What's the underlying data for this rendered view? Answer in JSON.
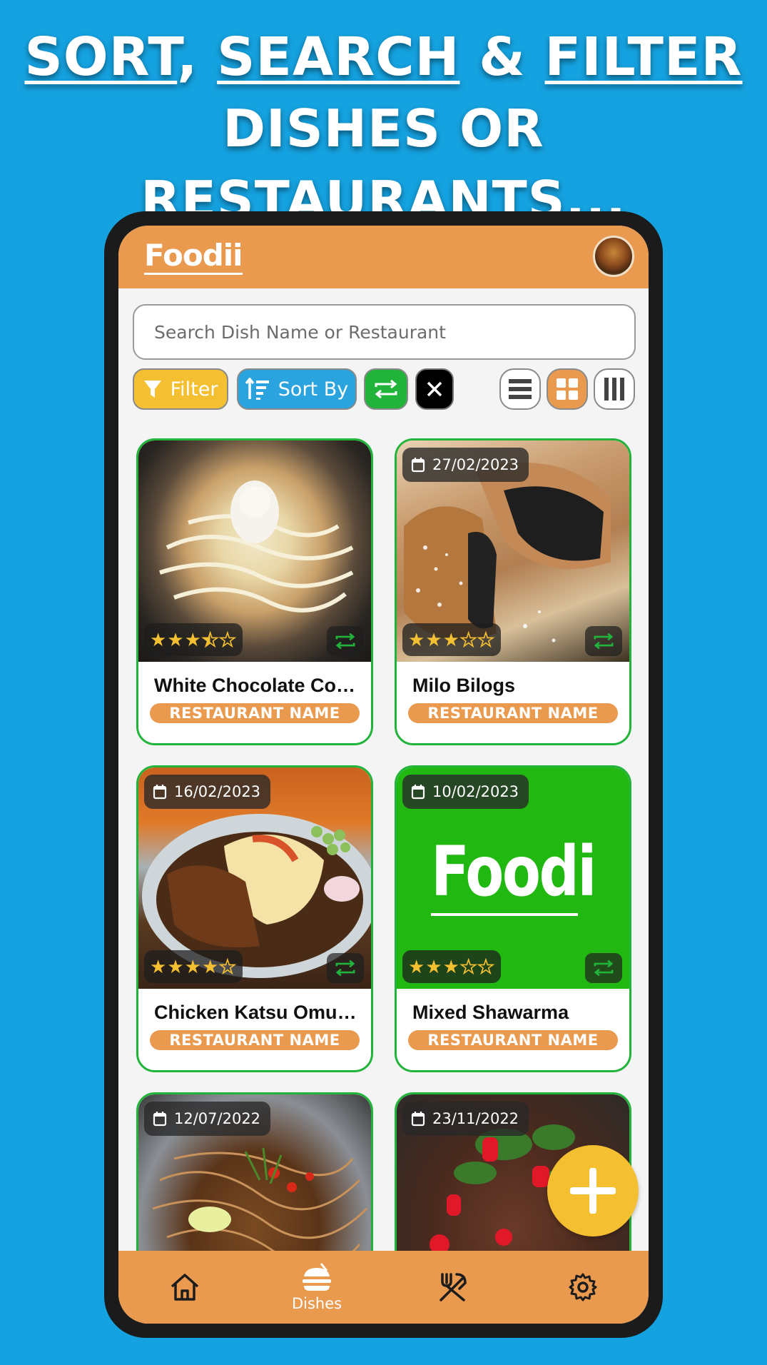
{
  "headline": {
    "sort": "SORT",
    "comma": ", ",
    "search": "SEARCH",
    "amp": " & ",
    "filter": "FILTER",
    "line2": "DISHES OR RESTAURANTS..."
  },
  "app": {
    "title": "Foodii",
    "accent": "#e99a4f",
    "search_placeholder": "Search Dish Name or Restaurant"
  },
  "toolbar": {
    "filter_label": "Filter",
    "sort_label": "Sort By"
  },
  "cards": [
    {
      "date": "",
      "dish": "White Chocolate Coo...",
      "restaurant": "RESTAURANT NAME",
      "rating": 3.5
    },
    {
      "date": "27/02/2023",
      "dish": "Milo Bilogs",
      "restaurant": "RESTAURANT NAME",
      "rating": 3
    },
    {
      "date": "16/02/2023",
      "dish": "Chicken Katsu Omuri...",
      "restaurant": "RESTAURANT NAME",
      "rating": 4
    },
    {
      "date": "10/02/2023",
      "dish": "Mixed Shawarma",
      "restaurant": "RESTAURANT NAME",
      "rating": 3,
      "placeholder_logo": "Foodi"
    },
    {
      "date": "12/07/2022",
      "dish": "",
      "restaurant": "",
      "rating": 0
    },
    {
      "date": "23/11/2022",
      "dish": "",
      "restaurant": "",
      "rating": 0
    }
  ],
  "nav": {
    "dishes_label": "Dishes"
  }
}
